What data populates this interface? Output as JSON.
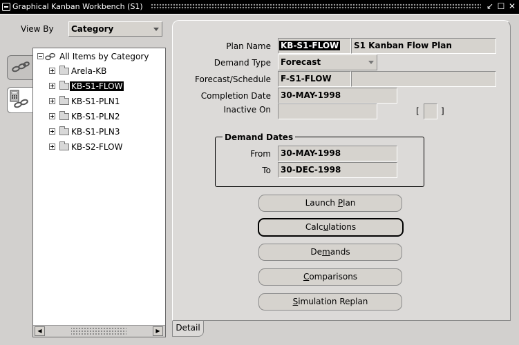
{
  "window": {
    "title": "Graphical Kanban Workbench (S1)",
    "controls": [
      "↙",
      "☐",
      "✕"
    ]
  },
  "view_by": {
    "label": "View By",
    "selected": "Category"
  },
  "tree": {
    "root": "All Items by Category",
    "items": [
      {
        "label": "Arela-KB",
        "selected": false
      },
      {
        "label": "KB-S1-FLOW",
        "selected": true
      },
      {
        "label": "KB-S1-PLN1",
        "selected": false
      },
      {
        "label": "KB-S1-PLN2",
        "selected": false
      },
      {
        "label": "KB-S1-PLN3",
        "selected": false
      },
      {
        "label": "KB-S2-FLOW",
        "selected": false
      }
    ]
  },
  "form": {
    "plan_name": {
      "label": "Plan Name",
      "code": "KB-S1-FLOW",
      "description": "S1 Kanban Flow Plan"
    },
    "demand_type": {
      "label": "Demand Type",
      "value": "Forecast"
    },
    "forecast_schedule": {
      "label": "Forecast/Schedule",
      "value": "F-S1-FLOW",
      "description": ""
    },
    "completion_date": {
      "label": "Completion Date",
      "value": "30-MAY-1998"
    },
    "inactive_on": {
      "label": "Inactive On",
      "value": "",
      "checkbox_open": "[",
      "checkbox_close": "]"
    },
    "demand_dates": {
      "title": "Demand Dates",
      "from_label": "From",
      "from_value": "30-MAY-1998",
      "to_label": "To",
      "to_value": "30-DEC-1998"
    }
  },
  "buttons": {
    "launch_plan": {
      "pre": "Launch ",
      "u": "P",
      "post": "lan"
    },
    "calculations": {
      "pre": "Calc",
      "u": "u",
      "post": "lations"
    },
    "demands": {
      "pre": "De",
      "u": "m",
      "post": "ands"
    },
    "comparisons": {
      "pre": "",
      "u": "C",
      "post": "omparisons"
    },
    "simulation_replan": {
      "pre": "",
      "u": "S",
      "post": "imulation Replan"
    }
  },
  "tabs": {
    "detail": "Detail"
  }
}
